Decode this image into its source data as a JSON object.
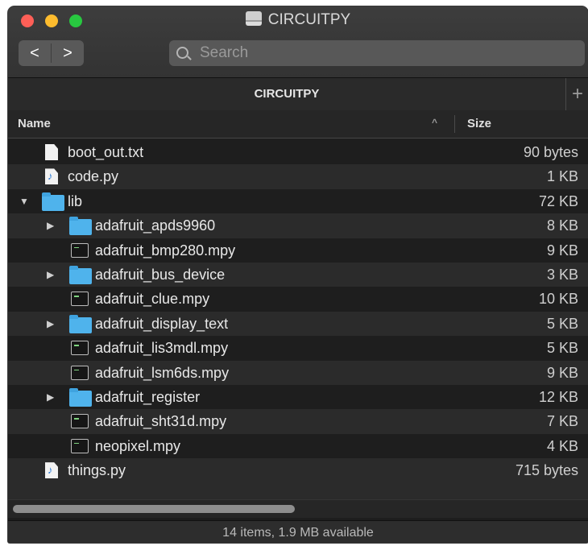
{
  "window": {
    "title": "CIRCUITPY",
    "icons": {
      "close": "close-icon",
      "minimize": "minimize-icon",
      "zoom": "zoom-icon",
      "drive": "drive-icon"
    }
  },
  "toolbar": {
    "back_glyph": "<",
    "forward_glyph": ">",
    "search_placeholder": "Search"
  },
  "tabbar": {
    "tab_label": "CIRCUITPY",
    "add_glyph": "+"
  },
  "columns": {
    "name": "Name",
    "size": "Size",
    "sort_glyph": "^"
  },
  "rows": [
    {
      "name": "boot_out.txt",
      "size": "90 bytes",
      "kind": "doc",
      "level": 0,
      "disclosure": ""
    },
    {
      "name": "code.py",
      "size": "1 KB",
      "kind": "py",
      "level": 0,
      "disclosure": ""
    },
    {
      "name": "lib",
      "size": "72 KB",
      "kind": "folder",
      "level": 0,
      "disclosure": "▼"
    },
    {
      "name": "adafruit_apds9960",
      "size": "8 KB",
      "kind": "folder",
      "level": 1,
      "disclosure": "▶"
    },
    {
      "name": "adafruit_bmp280.mpy",
      "size": "9 KB",
      "kind": "mpy",
      "level": 1,
      "disclosure": ""
    },
    {
      "name": "adafruit_bus_device",
      "size": "3 KB",
      "kind": "folder",
      "level": 1,
      "disclosure": "▶"
    },
    {
      "name": "adafruit_clue.mpy",
      "size": "10 KB",
      "kind": "mpy",
      "level": 1,
      "disclosure": ""
    },
    {
      "name": "adafruit_display_text",
      "size": "5 KB",
      "kind": "folder",
      "level": 1,
      "disclosure": "▶"
    },
    {
      "name": "adafruit_lis3mdl.mpy",
      "size": "5 KB",
      "kind": "mpy",
      "level": 1,
      "disclosure": ""
    },
    {
      "name": "adafruit_lsm6ds.mpy",
      "size": "9 KB",
      "kind": "mpy",
      "level": 1,
      "disclosure": ""
    },
    {
      "name": "adafruit_register",
      "size": "12 KB",
      "kind": "folder",
      "level": 1,
      "disclosure": "▶"
    },
    {
      "name": "adafruit_sht31d.mpy",
      "size": "7 KB",
      "kind": "mpy",
      "level": 1,
      "disclosure": ""
    },
    {
      "name": "neopixel.mpy",
      "size": "4 KB",
      "kind": "mpy",
      "level": 1,
      "disclosure": ""
    },
    {
      "name": "things.py",
      "size": "715 bytes",
      "kind": "py",
      "level": 0,
      "disclosure": ""
    }
  ],
  "status": {
    "text": "14 items, 1.9 MB available"
  },
  "colors": {
    "folder": "#4fb3ec",
    "window_bg": "#1e1e1e",
    "row_alt": "#2b2b2b"
  }
}
